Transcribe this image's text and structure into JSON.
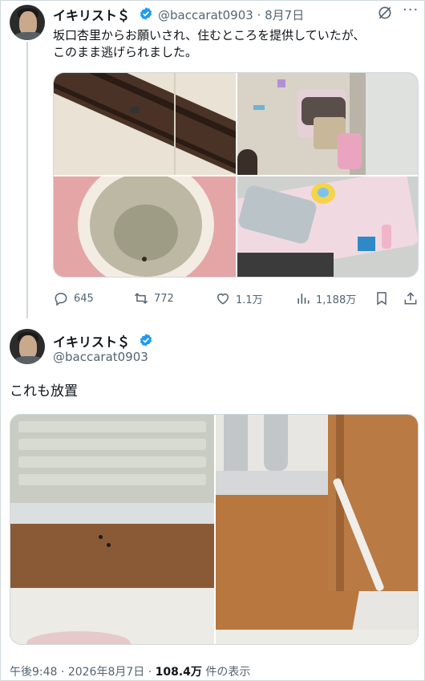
{
  "tweet1": {
    "display_name": "イキリスト＄",
    "handle": "@baccarat0903",
    "date": "8月7日",
    "text_line1": "坂口杏里からお願いされ、住むところを提供していたが、",
    "text_line2": "このまま逃げられました。",
    "stats": {
      "replies": "645",
      "retweets": "772",
      "likes": "1.1万",
      "views": "1,188万"
    },
    "photos": [
      "floor-rail-photo",
      "messy-room-photo",
      "toilet-photo",
      "mattress-photo"
    ]
  },
  "tweet2": {
    "display_name": "イキリスト＄",
    "handle": "@baccarat0903",
    "text": "これも放置",
    "photos": [
      "bathroom-floor-photo",
      "door-sill-photo"
    ],
    "time": "午後9:48",
    "date": "2026年8月7日",
    "views": "108.4万",
    "views_suffix": "件の表示"
  },
  "colors": {
    "verified": "#1d9bf0",
    "text": "#0f1419",
    "muted": "#536471",
    "border": "#cfd9de"
  },
  "icons": [
    "grok-icon",
    "more-icon",
    "reply-icon",
    "retweet-icon",
    "like-icon",
    "views-icon",
    "bookmark-icon",
    "share-icon",
    "verified-icon"
  ]
}
